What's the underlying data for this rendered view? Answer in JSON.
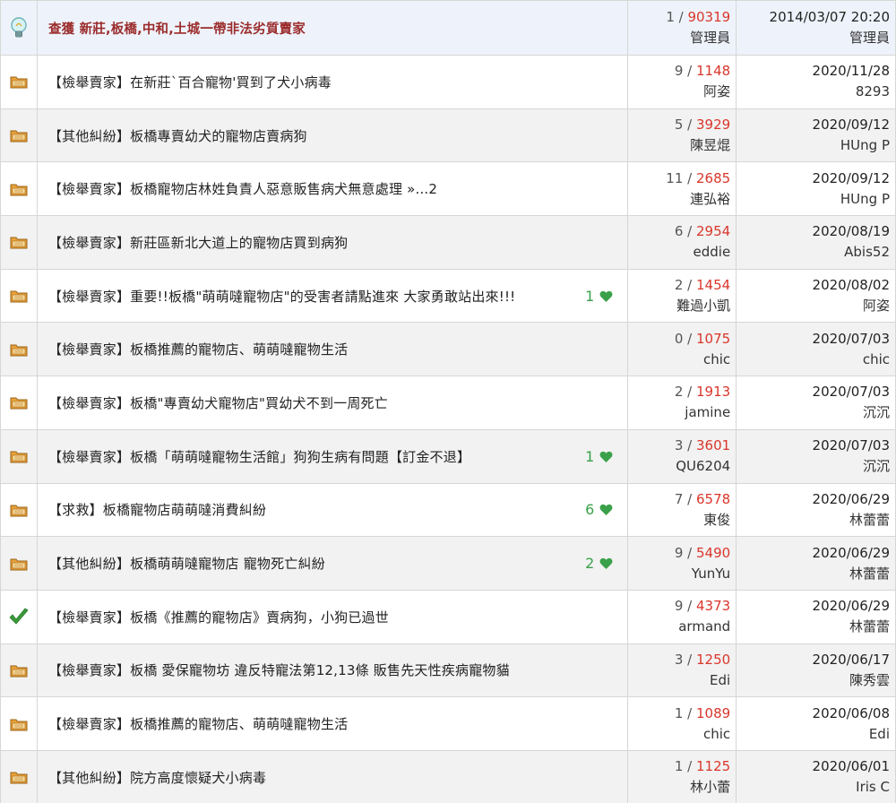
{
  "threads": [
    {
      "title": "查獲 新莊,板橋,中和,土城一帶非法劣質賣家",
      "icon": "lightbulb-icon",
      "likes": "",
      "replies": "1",
      "views": "90319",
      "starter": "管理員",
      "last_date": "2014/03/07 20:20",
      "last_user": "管理員"
    },
    {
      "title": "【檢舉賣家】在新莊`百合寵物'買到了犬小病毒",
      "icon": "folder-icon",
      "likes": "",
      "replies": "9",
      "views": "1148",
      "starter": "阿姿",
      "last_date": "2020/11/28",
      "last_user": "8293"
    },
    {
      "title": "【其他糾紛】板橋專賣幼犬的寵物店賣病狗",
      "icon": "folder-icon",
      "likes": "",
      "replies": "5",
      "views": "3929",
      "starter": "陳昱焜",
      "last_date": "2020/09/12",
      "last_user": "HUng P"
    },
    {
      "title": "【檢舉賣家】板橋寵物店林姓負責人惡意販售病犬無意處理 »...2",
      "icon": "folder-icon",
      "likes": "",
      "replies": "11",
      "views": "2685",
      "starter": "連弘裕",
      "last_date": "2020/09/12",
      "last_user": "HUng P"
    },
    {
      "title": "【檢舉賣家】新莊區新北大道上的寵物店買到病狗",
      "icon": "folder-icon",
      "likes": "",
      "replies": "6",
      "views": "2954",
      "starter": "eddie",
      "last_date": "2020/08/19",
      "last_user": "Abis52"
    },
    {
      "title": "【檢舉賣家】重要!!板橋\"萌萌噠寵物店\"的受害者請點進來 大家勇敢站出來!!!",
      "icon": "folder-icon",
      "likes": "1",
      "replies": "2",
      "views": "1454",
      "starter": "難過小凱",
      "last_date": "2020/08/02",
      "last_user": "阿姿"
    },
    {
      "title": "【檢舉賣家】板橋推薦的寵物店、萌萌噠寵物生活",
      "icon": "folder-icon",
      "likes": "",
      "replies": "0",
      "views": "1075",
      "starter": "chic",
      "last_date": "2020/07/03",
      "last_user": "chic"
    },
    {
      "title": "【檢舉賣家】板橋\"專賣幼犬寵物店\"買幼犬不到一周死亡",
      "icon": "folder-icon",
      "likes": "",
      "replies": "2",
      "views": "1913",
      "starter": "jamine",
      "last_date": "2020/07/03",
      "last_user": "沉沉"
    },
    {
      "title": "【檢舉賣家】板橋「萌萌噠寵物生活館」狗狗生病有問題【訂金不退】",
      "icon": "folder-icon",
      "likes": "1",
      "replies": "3",
      "views": "3601",
      "starter": "QU6204",
      "last_date": "2020/07/03",
      "last_user": "沉沉"
    },
    {
      "title": "【求救】板橋寵物店萌萌噠消費糾紛",
      "icon": "folder-icon",
      "likes": "6",
      "replies": "7",
      "views": "6578",
      "starter": "東俊",
      "last_date": "2020/06/29",
      "last_user": "林蕾蕾"
    },
    {
      "title": "【其他糾紛】板橋萌萌噠寵物店 寵物死亡糾紛",
      "icon": "folder-icon",
      "likes": "2",
      "replies": "9",
      "views": "5490",
      "starter": "YunYu",
      "last_date": "2020/06/29",
      "last_user": "林蕾蕾"
    },
    {
      "title": "【檢舉賣家】板橋《推薦的寵物店》賣病狗，小狗已過世",
      "icon": "checkmark-icon",
      "likes": "",
      "replies": "9",
      "views": "4373",
      "starter": "armand",
      "last_date": "2020/06/29",
      "last_user": "林蕾蕾"
    },
    {
      "title": "【檢舉賣家】板橋 愛保寵物坊 違反特寵法第12,13條 販售先天性疾病寵物貓",
      "icon": "folder-icon",
      "likes": "",
      "replies": "3",
      "views": "1250",
      "starter": "Edi",
      "last_date": "2020/06/17",
      "last_user": "陳秀雲"
    },
    {
      "title": "【檢舉賣家】板橋推薦的寵物店、萌萌噠寵物生活",
      "icon": "folder-icon",
      "likes": "",
      "replies": "1",
      "views": "1089",
      "starter": "chic",
      "last_date": "2020/06/08",
      "last_user": "Edi"
    },
    {
      "title": "【其他糾紛】院方高度懷疑犬小病毒",
      "icon": "folder-icon",
      "likes": "",
      "replies": "1",
      "views": "1125",
      "starter": "林小蕾",
      "last_date": "2020/06/01",
      "last_user": "Iris C"
    }
  ],
  "colors": {
    "views": "#d9362b",
    "pinned_title": "#9b2c2c",
    "likes": "#3aa14a",
    "folder": "#e8a13a"
  }
}
